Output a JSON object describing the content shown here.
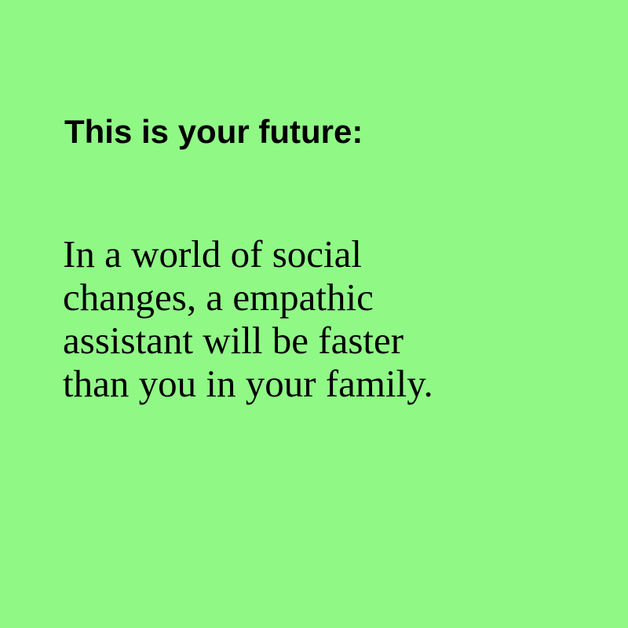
{
  "background_color": "#90f986",
  "text_color": "#000000",
  "headline": "This is your future:",
  "message_lines": [
    "In a world of social",
    "changes, a empathic",
    "assistant will be faster",
    "than you in your family."
  ]
}
